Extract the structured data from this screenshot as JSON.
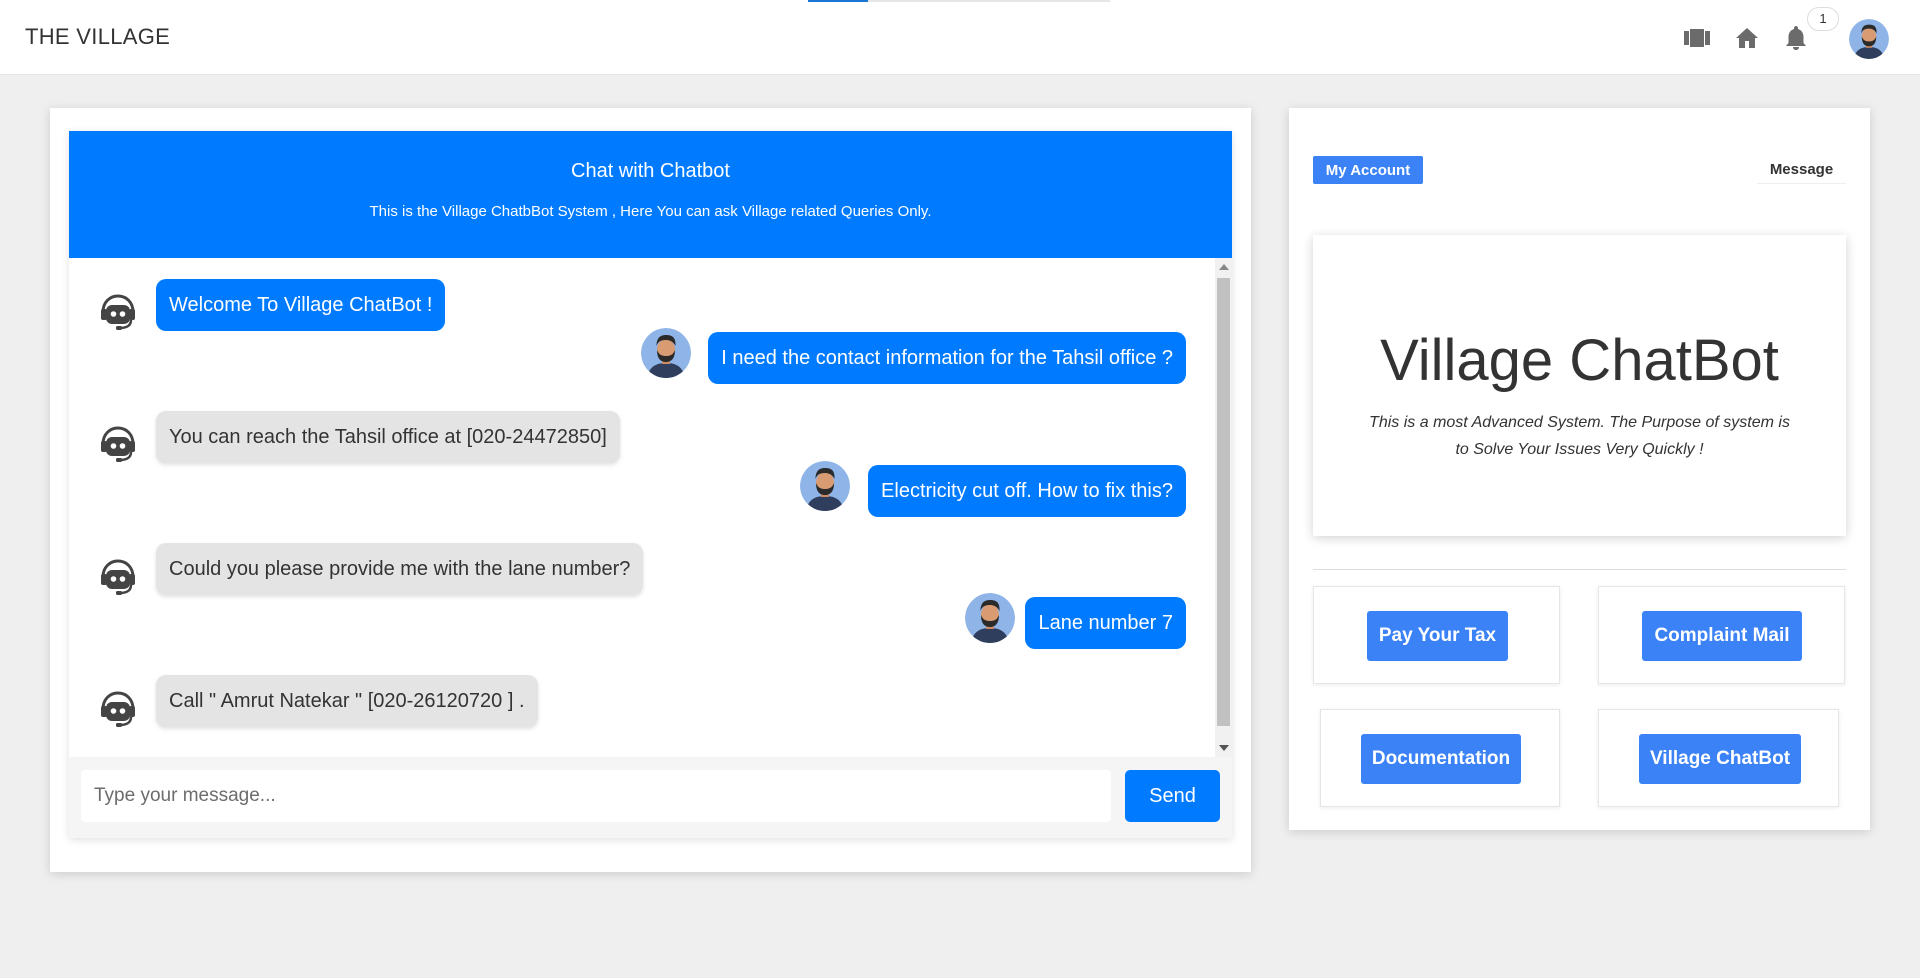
{
  "app": {
    "brand": "THE VILLAGE"
  },
  "topbar": {
    "icons": [
      "film-icon",
      "home-icon",
      "bell-icon"
    ],
    "notification_count": "1",
    "progress": 0.2
  },
  "chat": {
    "title": "Chat with Chatbot",
    "subtitle": "This is the Village ChatbBot System , Here You can ask Village related Queries Only.",
    "messages": [
      {
        "sender": "bot",
        "text": "Welcome To Village ChatBot !"
      },
      {
        "sender": "user",
        "text": "I need the contact information for the Tahsil office ?"
      },
      {
        "sender": "bot",
        "text": "You can reach the Tahsil office at [020-24472850]"
      },
      {
        "sender": "user",
        "text": "Electricity cut off. How to fix this?"
      },
      {
        "sender": "bot",
        "text": "Could you please provide me with the lane number?"
      },
      {
        "sender": "user",
        "text": "Lane number 7"
      },
      {
        "sender": "bot",
        "text": "Call \" Amrut Natekar \" [020-26120720 ] ."
      }
    ],
    "input_placeholder": "Type your message...",
    "input_value": "",
    "send_label": "Send"
  },
  "sidebar": {
    "my_account_label": "My Account",
    "message_label": "Message",
    "hero_title": "Village ChatBot",
    "hero_desc": "This is a most Advanced System. The Purpose of system is to Solve Your Issues Very Quickly !",
    "tiles": [
      {
        "label": "Pay Your Tax"
      },
      {
        "label": "Complaint Mail"
      },
      {
        "label": "Documentation"
      },
      {
        "label": "Village ChatBot"
      }
    ]
  },
  "colors": {
    "primary": "#007bff",
    "button": "#3b82f6",
    "bot_bubble": "#e4e4e4"
  }
}
